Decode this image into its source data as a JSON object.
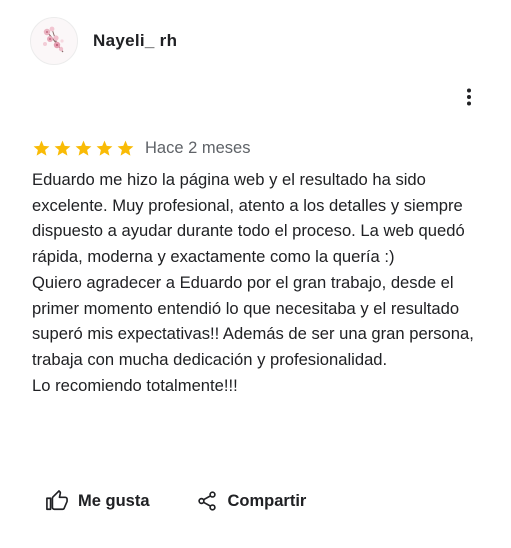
{
  "review": {
    "author_name": "Nayeli_ rh",
    "rating": 5,
    "max_rating": 5,
    "date": "Hace 2 meses",
    "paragraphs": [
      "Eduardo me hizo la página web y el resultado ha sido excelente. Muy profesional, atento a los detalles y siempre dispuesto a ayudar durante todo el proceso. La web quedó rápida, moderna y exactamente como la quería :)",
      "Quiero agradecer a Eduardo por el gran trabajo, desde el primer momento entendió lo que necesitaba y el resultado superó mis expectativas!! Además de ser una gran persona, trabaja con mucha dedicación y profesionalidad.",
      "Lo recomiendo totalmente!!!"
    ]
  },
  "actions": {
    "like_label": "Me gusta",
    "share_label": "Compartir"
  },
  "icons": {
    "star": "star-icon",
    "more": "more-vert-icon",
    "like": "thumb-up-icon",
    "share": "share-icon"
  },
  "colors": {
    "star": "#F9BB06",
    "text": "#202124",
    "secondary_text": "#5F6368"
  }
}
